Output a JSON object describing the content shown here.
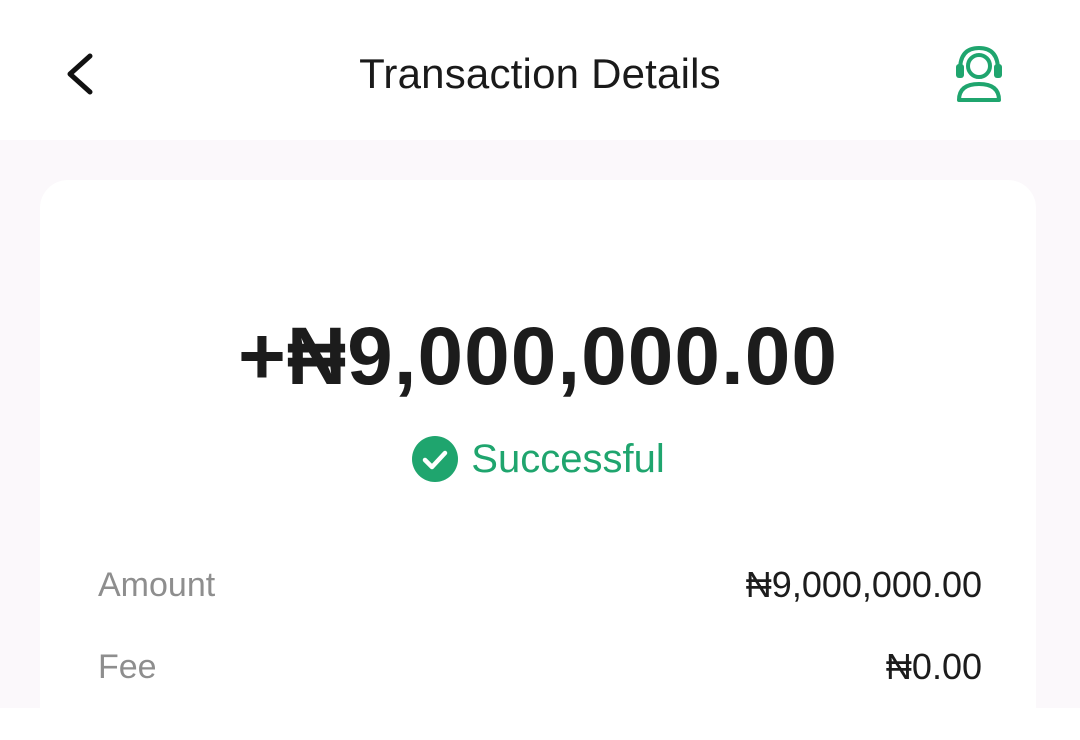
{
  "header": {
    "title": "Transaction Details",
    "back_icon": "chevron-left-icon",
    "support_icon": "customer-support-headset-icon"
  },
  "transaction": {
    "amount_display": "+₦9,000,000.00",
    "status": {
      "label": "Successful",
      "icon": "check-circle-icon",
      "color": "#1fa56e"
    },
    "details": [
      {
        "label": "Amount",
        "value": "₦9,000,000.00"
      },
      {
        "label": "Fee",
        "value": "₦0.00"
      }
    ]
  },
  "colors": {
    "accent": "#1fa56e",
    "background": "#fbf8fb",
    "card": "#ffffff",
    "label_gray": "#8e8e8e",
    "text_dark": "#1c1c1c"
  }
}
